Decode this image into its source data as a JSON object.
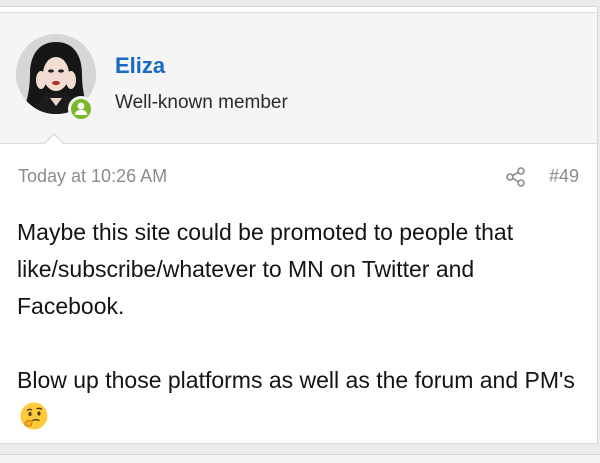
{
  "user": {
    "name": "Eliza",
    "title": "Well-known member",
    "avatar_icon": "avatar-image",
    "status_icon": "online-user-icon",
    "status_color": "#7ab929"
  },
  "post": {
    "date": "Today at 10:26 AM",
    "share_icon": "share-icon",
    "number": "#49",
    "paragraph_1": "Maybe this site could be promoted to people that like/subscribe/whatever to MN on Twitter and Facebook.",
    "paragraph_2": "Blow up those platforms as well as the forum and PM's",
    "emoji_icon": "thinking-face-emoji"
  },
  "colors": {
    "username": "#1769c4",
    "meta_text": "#8b8b8b",
    "header_bg": "#f5f5f5"
  }
}
